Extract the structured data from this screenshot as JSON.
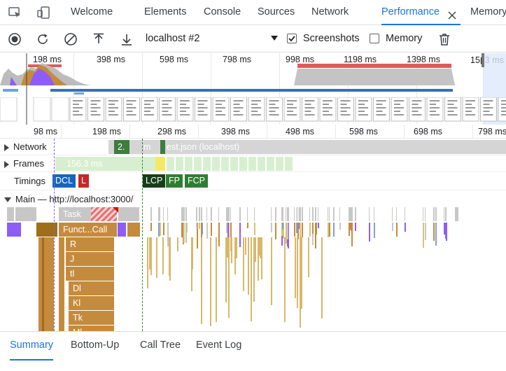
{
  "tabbar": {
    "tabs": [
      {
        "label": "Welcome"
      },
      {
        "label": "Elements"
      },
      {
        "label": "Console"
      },
      {
        "label": "Sources"
      },
      {
        "label": "Network"
      },
      {
        "label": "Performance",
        "active": true
      },
      {
        "label": "Memory"
      }
    ]
  },
  "toolbar": {
    "profile_name": "localhost #2",
    "screenshots_label": "Screenshots",
    "screenshots_checked": true,
    "memory_label": "Memory",
    "memory_checked": false
  },
  "overview": {
    "ticks": [
      "198 ms",
      "398 ms",
      "598 ms",
      "798 ms",
      "998 ms",
      "1198 ms",
      "1398 ms",
      "15▮3 ms"
    ]
  },
  "ruler": {
    "ticks": [
      "98 ms",
      "198 ms",
      "298 ms",
      "398 ms",
      "498 ms",
      "598 ms",
      "698 ms",
      "798 ms"
    ]
  },
  "tracks": {
    "network_label": "Network",
    "network_items": [
      "2.",
      "m",
      "est.json (localhost)"
    ],
    "frames_label": "Frames",
    "frame_time": "156.3 ms",
    "timings_label": "Timings",
    "timing_markers": [
      "DCL",
      "L",
      "LCP",
      "FP",
      "FCP"
    ],
    "main_label": "Main — http://localhost:3000/",
    "flame": [
      "Task",
      "Funct...Call",
      "R",
      "J",
      "tl",
      "Dl",
      "Kl",
      "Tk",
      "Ml"
    ]
  },
  "colors": {
    "accent": "#1a73e8",
    "dcl": "#1565c0",
    "load": "#c62828",
    "lcp": "#1b5e20",
    "fp": "#2e7d32",
    "fcp": "#2e7d32",
    "scripting": "#c58b3c",
    "task": "#c7c7c7"
  },
  "bottom_tabs": [
    {
      "label": "Summary",
      "active": true
    },
    {
      "label": "Bottom-Up"
    },
    {
      "label": "Call Tree"
    },
    {
      "label": "Event Log"
    }
  ]
}
